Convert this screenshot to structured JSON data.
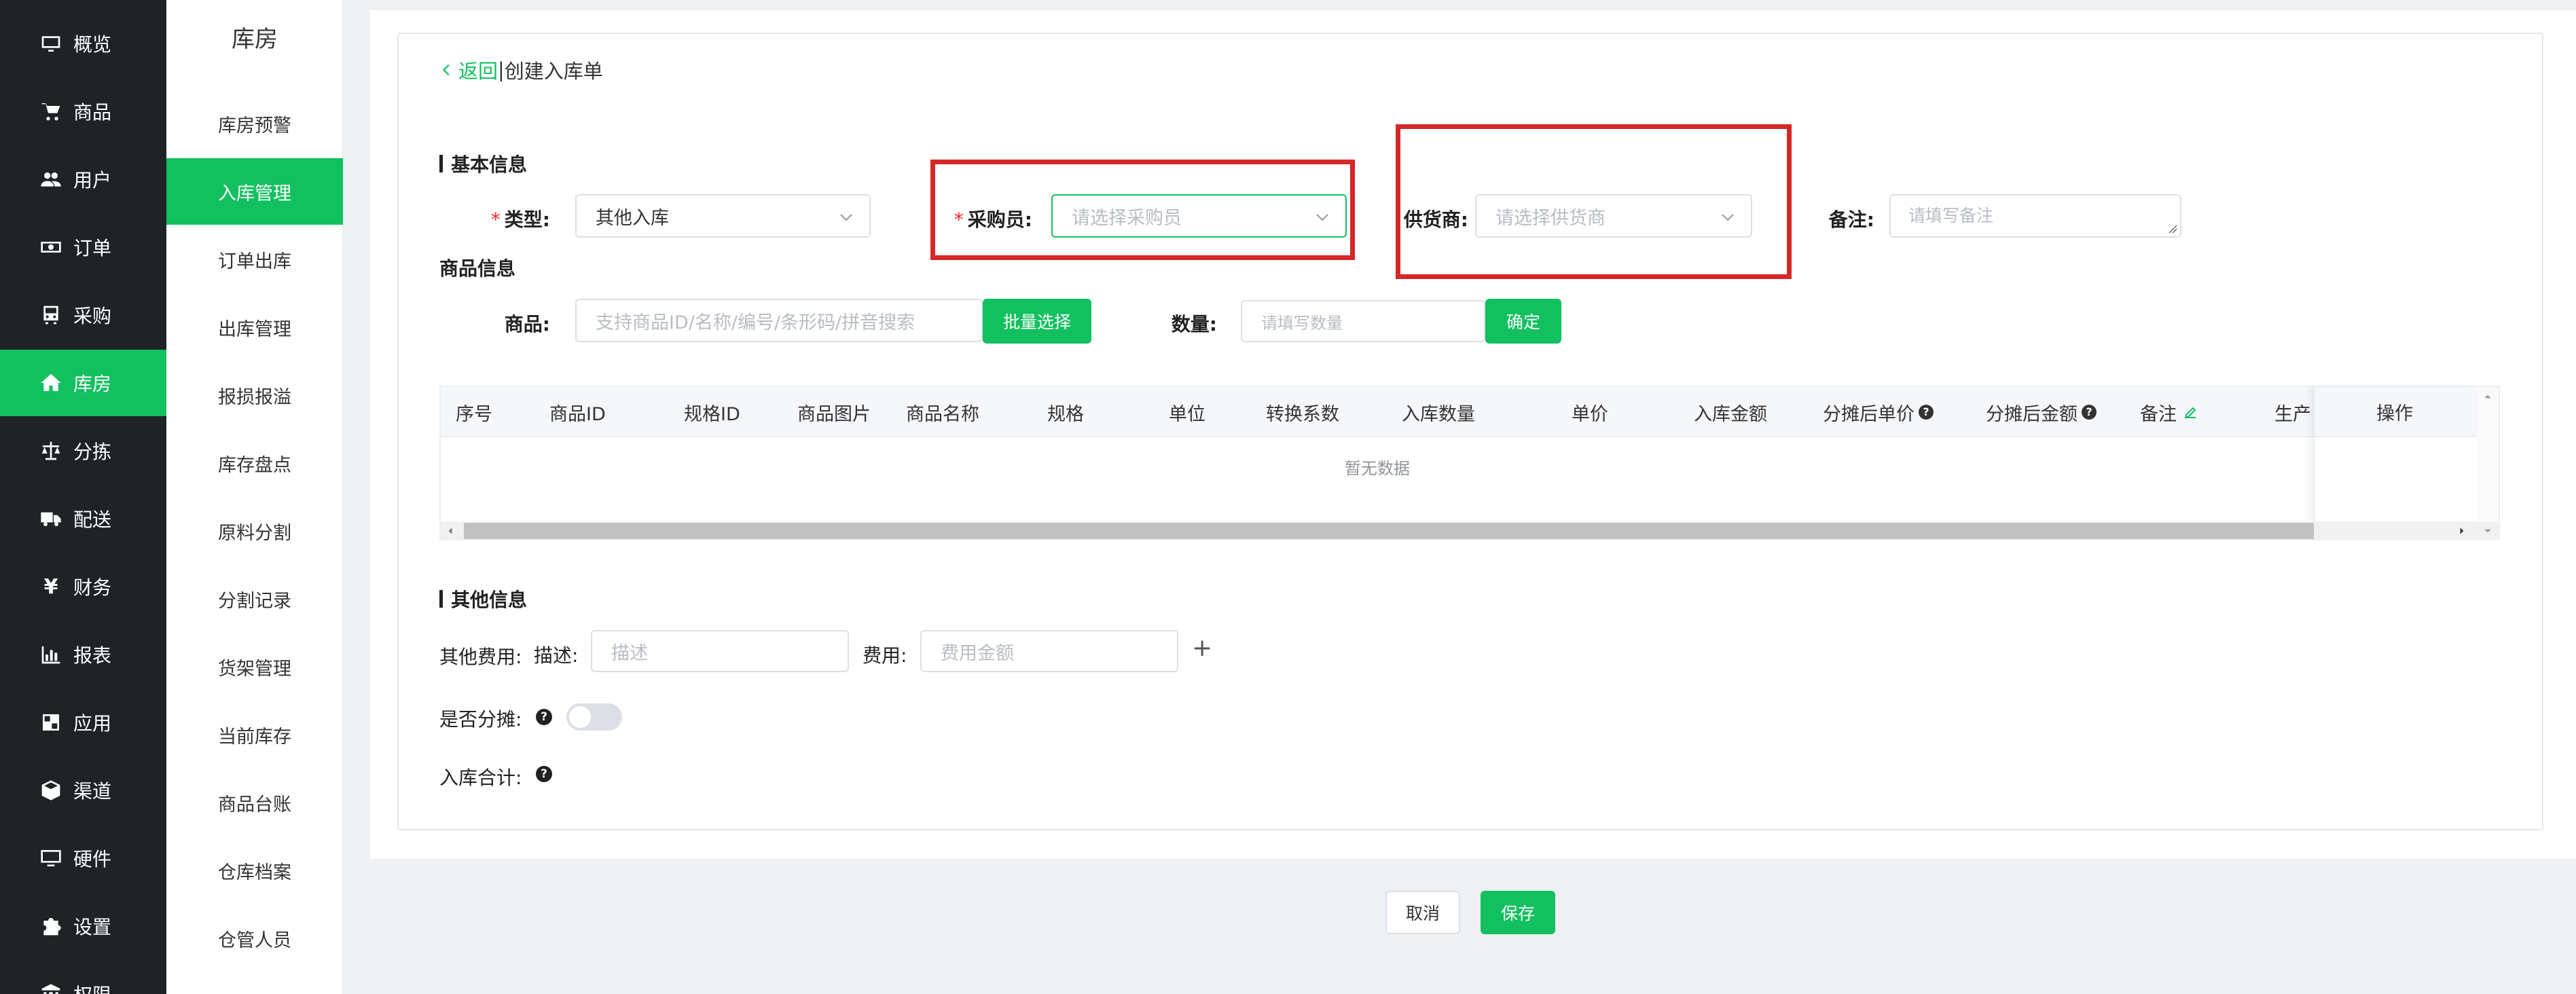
{
  "primary_nav": [
    {
      "label": "概览",
      "icon": "monitor-icon"
    },
    {
      "label": "商品",
      "icon": "cart-icon"
    },
    {
      "label": "用户",
      "icon": "users-icon"
    },
    {
      "label": "订单",
      "icon": "money-icon"
    },
    {
      "label": "采购",
      "icon": "truck-front-icon"
    },
    {
      "label": "库房",
      "icon": "home-icon",
      "active": true
    },
    {
      "label": "分拣",
      "icon": "scale-icon"
    },
    {
      "label": "配送",
      "icon": "truck-icon"
    },
    {
      "label": "财务",
      "icon": "yen-icon"
    },
    {
      "label": "报表",
      "icon": "bar-chart-icon"
    },
    {
      "label": "应用",
      "icon": "apps-icon"
    },
    {
      "label": "渠道",
      "icon": "cube-icon"
    },
    {
      "label": "硬件",
      "icon": "desktop-icon"
    },
    {
      "label": "设置",
      "icon": "puzzle-icon"
    },
    {
      "label": "权限",
      "icon": "bank-icon"
    }
  ],
  "secondary_nav": {
    "title": "库房",
    "items": [
      {
        "label": "库房预警"
      },
      {
        "label": "入库管理",
        "active": true
      },
      {
        "label": "订单出库"
      },
      {
        "label": "出库管理"
      },
      {
        "label": "报损报溢"
      },
      {
        "label": "库存盘点"
      },
      {
        "label": "原料分割"
      },
      {
        "label": "分割记录"
      },
      {
        "label": "货架管理"
      },
      {
        "label": "当前库存"
      },
      {
        "label": "商品台账"
      },
      {
        "label": "仓库档案"
      },
      {
        "label": "仓管人员"
      }
    ]
  },
  "header": {
    "back": "返回",
    "sep": "|",
    "title": "创建入库单"
  },
  "basic_info": {
    "section_title": "基本信息",
    "type_label": "类型:",
    "type_value": "其他入库",
    "buyer_label": "采购员:",
    "buyer_placeholder": "请选择采购员",
    "supplier_label": "供货商:",
    "supplier_placeholder": "请选择供货商",
    "remark_label": "备注:",
    "remark_placeholder": "请填写备注"
  },
  "goods_info": {
    "section_title": "商品信息",
    "goods_label": "商品:",
    "goods_placeholder": "支持商品ID/名称/编号/条形码/拼音搜索",
    "batch_button": "批量选择",
    "qty_label": "数量:",
    "qty_placeholder": "请填写数量",
    "confirm_button": "确定"
  },
  "table": {
    "columns": [
      "序号",
      "商品ID",
      "规格ID",
      "商品图片",
      "商品名称",
      "规格",
      "单位",
      "转换系数",
      "入库数量",
      "单价",
      "入库金额",
      "分摊后单价",
      "分摊后金额",
      "备注",
      "生产"
    ],
    "action_column": "操作",
    "empty_text": "暂无数据"
  },
  "other_info": {
    "section_title": "其他信息",
    "fee_label": "其他费用:",
    "desc_label": "描述:",
    "desc_placeholder": "描述",
    "amount_label": "费用:",
    "amount_placeholder": "费用金额",
    "allocate_label": "是否分摊:",
    "total_label": "入库合计:"
  },
  "footer": {
    "cancel": "取消",
    "save": "保存"
  },
  "colors": {
    "brand": "#12c05f",
    "sidebar_bg": "#1f2326",
    "highlight": "#d62828"
  }
}
